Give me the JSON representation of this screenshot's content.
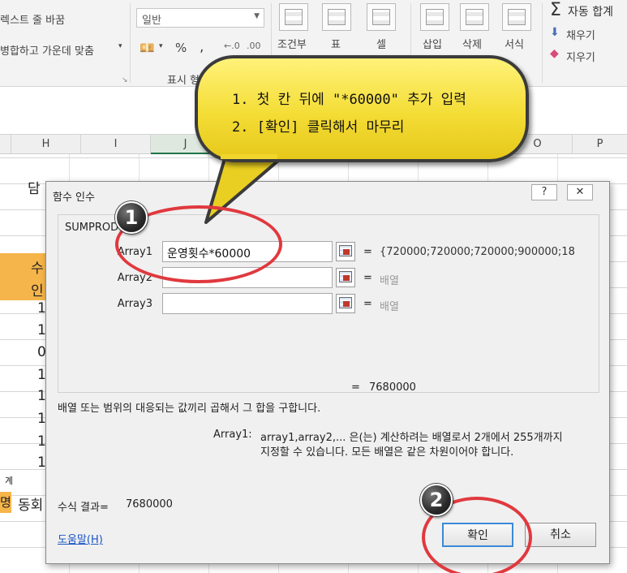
{
  "ribbon": {
    "wrap_text": "렉스트 줄 바꿈",
    "merge_center": "병합하고 가운데 맞춤",
    "number_format": "일반",
    "percent": "%",
    "comma": ",",
    "conditional": "조건부",
    "table": "표",
    "cell": "셀",
    "insert": "삽입",
    "delete": "삭제",
    "format": "서식",
    "autosum": "자동 합계",
    "fill": "채우기",
    "clear": "지우기",
    "display_group": "표시 형"
  },
  "columns": [
    "H",
    "I",
    "J",
    "O",
    "P"
  ],
  "sheet": {
    "cells": [
      "담",
      "수",
      "인",
      "1",
      "1",
      "0",
      "1",
      "1",
      "1",
      "1",
      "1",
      "동회",
      "명",
      "계"
    ]
  },
  "dialog": {
    "title": "함수 인수",
    "help_glyph": "?",
    "close_glyph": "✕",
    "function_name": "SUMPRODUCT",
    "args": [
      {
        "label": "Array1",
        "value": "운영횟수*60000",
        "eq": "=",
        "result": "{720000;720000;720000;900000;18",
        "placeholder": false
      },
      {
        "label": "Array2",
        "value": "",
        "eq": "=",
        "result": "배열",
        "placeholder": true
      },
      {
        "label": "Array3",
        "value": "",
        "eq": "=",
        "result": "배열",
        "placeholder": true
      }
    ],
    "total_eq": "=",
    "total_value": "7680000",
    "description": "배열 또는 범위의 대응되는 값끼리 곱해서 그 합을 구합니다.",
    "arg_help_label": "Array1:",
    "arg_help_line1": "array1,array2,... 은(는) 계산하려는 배열로서 2개에서 255개까지",
    "arg_help_line2": "지정할 수 있습니다. 모든 배열은 같은 차원이어야 합니다.",
    "formula_result_label": "수식 결과=",
    "formula_result_value": "7680000",
    "help_link": "도움말(H)",
    "ok": "확인",
    "cancel": "취소"
  },
  "callout": {
    "line1": "1. 첫 칸 뒤에 \"*60000\" 추가 입력",
    "line2": "2. [확인] 클릭해서 마무리"
  },
  "badges": {
    "one": "1",
    "two": "2"
  },
  "colors": {
    "highlight_red": "#e0393e",
    "callout_yellow": "#f4dd36",
    "header_orange": "#f6b54a"
  }
}
